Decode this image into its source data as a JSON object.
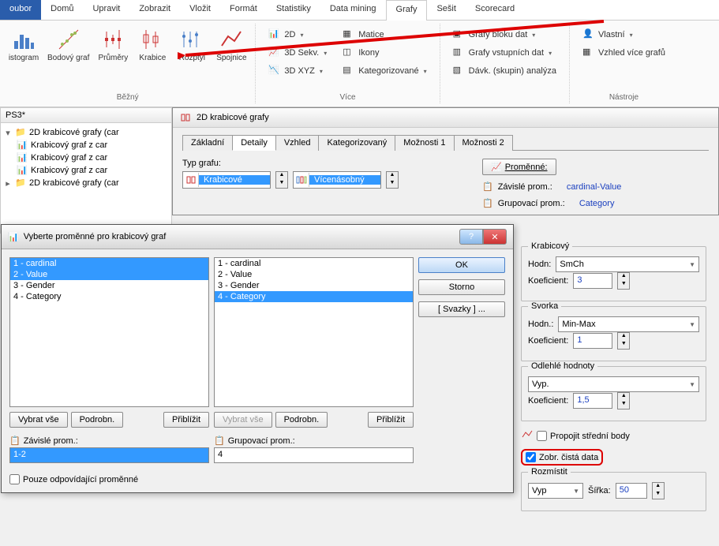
{
  "menu": {
    "items": [
      "oubor",
      "Domů",
      "Upravit",
      "Zobrazit",
      "Vložit",
      "Formát",
      "Statistiky",
      "Data mining",
      "Grafy",
      "Sešit",
      "Scorecard"
    ],
    "active": "Grafy",
    "highlight": "oubor"
  },
  "ribbon": {
    "group_common": {
      "title": "Běžný",
      "buttons": [
        {
          "label": "istogram",
          "icon": "histogram"
        },
        {
          "label": "Bodový graf",
          "icon": "scatter"
        },
        {
          "label": "Průměry",
          "icon": "means"
        },
        {
          "label": "Krabice",
          "icon": "boxplot"
        },
        {
          "label": "Rozptyl",
          "icon": "variance"
        },
        {
          "label": "Spojnice",
          "icon": "lines"
        }
      ]
    },
    "group_more": {
      "col1": [
        "3D Sekv.",
        "3D XYZ"
      ],
      "col1_top": "",
      "col2": [
        "Matice",
        "Ikony",
        "Kategorizované"
      ],
      "title": "Více"
    },
    "group_block": {
      "items": [
        "Grafy bloku dat",
        "Grafy vstupních dat",
        "Dávk. (skupin) analýza"
      ]
    },
    "group_tools": {
      "items": [
        "Vlastní",
        "Vzhled více grafů"
      ],
      "title": "Nástroje"
    }
  },
  "sidebar": {
    "title": "PS3*",
    "tree": [
      {
        "label": "2D krabicové grafy (car",
        "icon": "folder",
        "exp": "-"
      },
      {
        "label": "Krabicový graf z car",
        "icon": "chart",
        "indent": 1
      },
      {
        "label": "Krabicový graf z car",
        "icon": "chart",
        "indent": 1
      },
      {
        "label": "Krabicový graf z car",
        "icon": "chart",
        "indent": 1
      },
      {
        "label": "2D krabicové grafy (car",
        "icon": "folder",
        "exp": "+"
      }
    ]
  },
  "dlg_box": {
    "title": "2D krabicové grafy",
    "tabs": [
      "Základní",
      "Detaily",
      "Vzhled",
      "Kategorizovaný",
      "Možnosti 1",
      "Možnosti 2"
    ],
    "active_tab": "Detaily",
    "typ_label": "Typ grafu:",
    "typ1": "Krabicové",
    "typ2": "Vícenásobný",
    "vars_btn": "Proměnné:",
    "dep_label": "Závislé prom.:",
    "dep_value": "cardinal-Value",
    "grp_label": "Grupovací prom.:",
    "grp_value": "Category",
    "box": {
      "title": "Krabicový",
      "hodn_label": "Hodn:",
      "hodn_value": "SmCh",
      "koef_label": "Koeficient:",
      "koef_value": "3"
    },
    "whisker": {
      "title": "Svorka",
      "hodn_label": "Hodn.:",
      "hodn_value": "Min-Max",
      "koef_label": "Koeficient:",
      "koef_value": "1"
    },
    "outliers": {
      "title": "Odlehlé hodnoty",
      "mode": "Vyp.",
      "koef_label": "Koeficient:",
      "koef_value": "1,5"
    },
    "connect_label": "Propojit střední body",
    "rawdata_label": "Zobr. čistá data",
    "rozmistit": {
      "title": "Rozmístit",
      "mode": "Vyp",
      "width_label": "Šířka:",
      "width_value": "50"
    }
  },
  "dlg_vars": {
    "title": "Vyberte proměnné pro krabicový graf",
    "list1": [
      {
        "text": "1 - cardinal",
        "sel": true
      },
      {
        "text": "2 - Value",
        "sel": true
      },
      {
        "text": "3 - Gender",
        "sel": false
      },
      {
        "text": "4 - Category",
        "sel": false
      }
    ],
    "list2": [
      {
        "text": "1 - cardinal",
        "sel": false
      },
      {
        "text": "2 - Value",
        "sel": false
      },
      {
        "text": "3 - Gender",
        "sel": false
      },
      {
        "text": "4 - Category",
        "sel": true
      }
    ],
    "btn_selectall": "Vybrat vše",
    "btn_details": "Podrobn.",
    "btn_zoom": "Přiblížit",
    "dep_label": "Závislé prom.:",
    "dep_value": "1-2",
    "grp_label": "Grupovací prom.:",
    "grp_value": "4",
    "only_matching": "Pouze odpovídající proměnné",
    "ok": "OK",
    "cancel": "Storno",
    "bundles": "[ Svazky ] ..."
  }
}
